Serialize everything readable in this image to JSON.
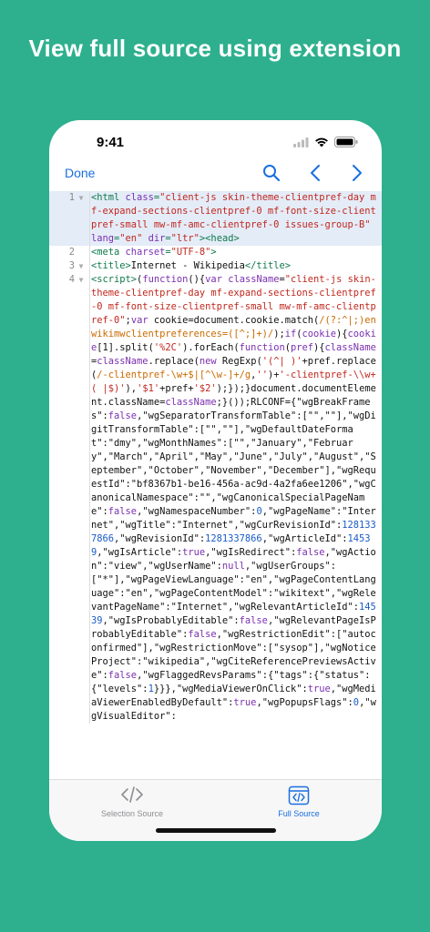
{
  "headline": "View full source using extension",
  "status": {
    "time": "9:41"
  },
  "nav": {
    "done_label": "Done"
  },
  "colors": {
    "background": "#2eb08e",
    "accent": "#1a6fe0"
  },
  "icons": {
    "search": "search-icon",
    "prev": "chevron-left-icon",
    "next": "chevron-right-icon",
    "selection_source": "code-icon",
    "full_source": "code-document-icon"
  },
  "source": {
    "line_numbers": [
      "1",
      "2",
      "3",
      "4"
    ],
    "line1": {
      "p1": "<html ",
      "p2": "class",
      "p3": "=",
      "p4": "\"client-js skin-theme-clientpref-day mf-expand-sections-clientpref-0 mf-font-size-clientpref-small mw-mf-amc-clientpref-0 issues-group-B\"",
      "p5": " ",
      "p6": "lang",
      "p7": "=",
      "p8": "\"en\"",
      "p9": " ",
      "p10": "dir",
      "p11": "=",
      "p12": "\"ltr\"",
      "p13": "><head>"
    },
    "line2": {
      "p1": "<meta ",
      "p2": "charset",
      "p3": "=",
      "p4": "\"UTF-8\"",
      "p5": ">"
    },
    "line3": {
      "p1": "<title>",
      "p2": "Internet - Wikipedia",
      "p3": "</title>"
    },
    "line4": {
      "p1": "<script>",
      "p2": "(",
      "p3": "function",
      "p4": "(){",
      "p5": "var",
      "p6": " ",
      "p7": "className",
      "p8": "=",
      "p9": "\"client-js skin-theme-clientpref-day mf-expand-sections-clientpref-0 mf-font-size-clientpref-small mw-mf-amc-clientpref-0\"",
      "p10": ";",
      "p11": "var",
      "p12": " cookie=document.cookie.match(",
      "p13": "/(?:^|;)enwikimwclientpreferences=([^;]+)/",
      "p14": ");",
      "p15": "if",
      "p16": "(",
      "p17": "cookie",
      "p18": "){",
      "p19": "cookie",
      "p20": "[1].split(",
      "p21": "'%2C'",
      "p22": ").forEach(",
      "p23": "function",
      "p24": "(",
      "p25": "pref",
      "p26": "){",
      "p27": "className",
      "p28": "=",
      "p29": "className",
      "p30": ".replace(",
      "p31": "new",
      "p32": " RegExp(",
      "p33": "'(^| )'",
      "p34": "+pref.replace(",
      "p35": "/-clientpref-\\w+$|[^\\w-]+/g",
      "p36": ",",
      "p37": "''",
      "p38": ")+",
      "p39": "'-clientpref-\\\\w+( |$)'",
      "p40": "),",
      "p41": "'$1'",
      "p42": "+pref+",
      "p43": "'$2'",
      "p44": ");});}document.documentElement.className=",
      "p45": "className",
      "p46": ";}());RLCONF=",
      "p47": "{\"wgBreakFrames\":",
      "p48": "false",
      "p49": ",\"wgSeparatorTransformTable\":[\"\",\"\"],\"wgDigitTransformTable\":[\"\",\"\"],\"wgDefaultDateFormat\":\"dmy\",\"wgMonthNames\":[\"\",\"January\",\"February\",\"March\",\"April\",\"May\",\"June\",\"July\",\"August\",\"September\",\"October\",\"November\",\"December\"],\"wgRequestId\":\"bf8367b1-be16-456a-ac9d-4a2fa6ee1206\",\"wgCanonicalNamespace\":\"\",\"wgCanonicalSpecialPageName\":",
      "p50": "false",
      "p51": ",\"wgNamespaceNumber\":",
      "p52": "0",
      "p53": ",\"wgPageName\":\"Internet\",\"wgTitle\":\"Internet\",\"wgCurRevisionId\":",
      "p54": "1281337866",
      "p55": ",\"wgRevisionId\":",
      "p56": "1281337866",
      "p57": ",\"wgArticleId\":",
      "p58": "14539",
      "p59": ",\"wgIsArticle\":",
      "p60": "true",
      "p61": ",\"wgIsRedirect\":",
      "p62": "false",
      "p63": ",\"wgAction\":\"view\",\"wgUserName\":",
      "p64": "null",
      "p65": ",\"wgUserGroups\":[\"*\"],\"wgPageViewLanguage\":\"en\",\"wgPageContentLanguage\":\"en\",\"wgPageContentModel\":\"wikitext\",\"wgRelevantPageName\":\"Internet\",\"wgRelevantArticleId\":",
      "p66": "14539",
      "p67": ",\"wgIsProbablyEditable\":",
      "p68": "false",
      "p69": ",\"wgRelevantPageIsProbablyEditable\":",
      "p70": "false",
      "p71": ",\"wgRestrictionEdit\":[\"autoconfirmed\"],\"wgRestrictionMove\":[\"sysop\"],\"wgNoticeProject\":\"wikipedia\",\"wgCiteReferencePreviewsActive\":",
      "p72": "false",
      "p73": ",\"wgFlaggedRevsParams\":{\"tags\":{\"status\":{\"levels\":",
      "p74": "1",
      "p75": "}}},\"wgMediaViewerOnClick\":",
      "p76": "true",
      "p77": ",\"wgMediaViewerEnabledByDefault\":",
      "p78": "true",
      "p79": ",\"wgPopupsFlags\":",
      "p80": "0",
      "p81": ",\"wgVisualEditor\":"
    }
  },
  "tabs": {
    "selection_source": "Selection Source",
    "full_source": "Full Source"
  }
}
